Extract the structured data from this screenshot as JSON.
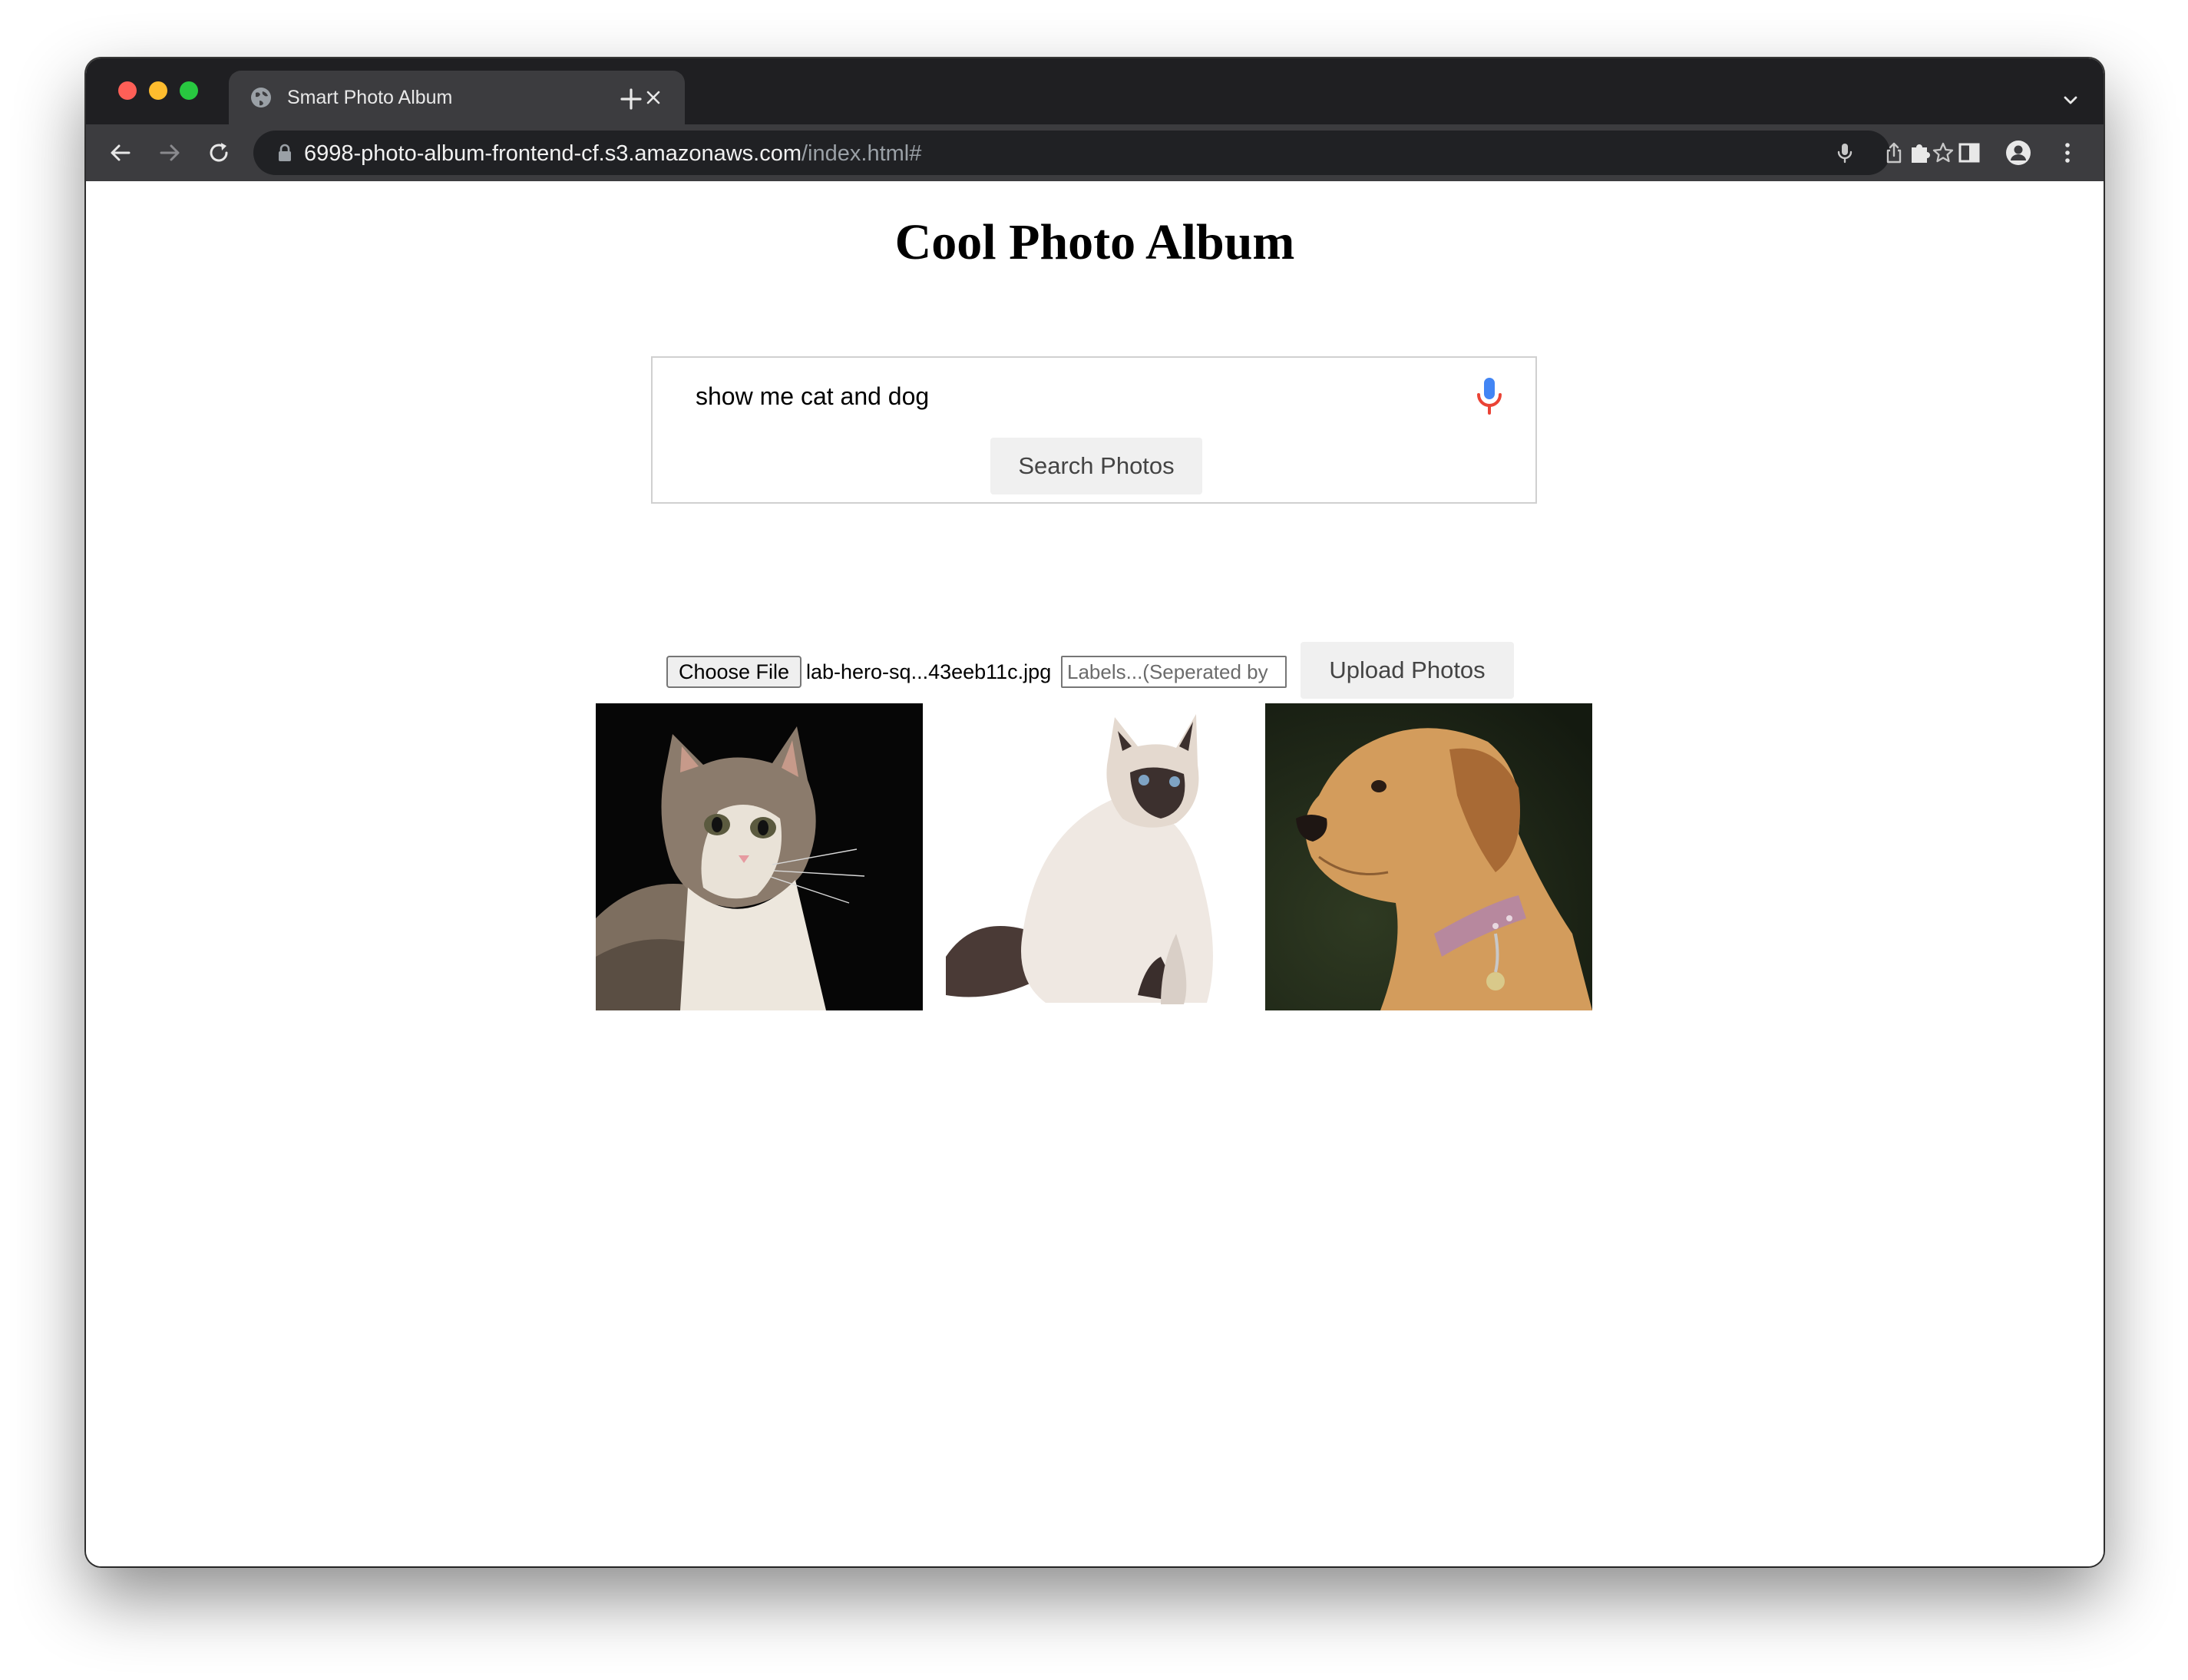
{
  "browser": {
    "tab": {
      "title": "Smart Photo Album"
    },
    "address_bar": {
      "host": "6998-photo-album-frontend-cf.s3.amazonaws.com",
      "path": "/index.html#"
    },
    "icons": {
      "tab_favicon": "globe-icon",
      "tab_close": "close-icon",
      "new_tab": "plus-icon",
      "tab_list": "chevron-down-icon",
      "back": "arrow-left-icon",
      "forward": "arrow-right-icon",
      "reload": "reload-icon",
      "lock": "lock-icon",
      "voice_search": "microphone-icon",
      "share": "share-icon",
      "bookmark": "star-icon",
      "extensions": "puzzle-icon",
      "side_panel": "side-panel-icon",
      "profile": "profile-icon",
      "menu": "kebab-menu-icon"
    }
  },
  "page": {
    "title": "Cool Photo Album",
    "search": {
      "query": "show me cat and dog",
      "button_label": "Search Photos",
      "mic_icon": "microphone-icon"
    },
    "upload": {
      "choose_file_label": "Choose File",
      "file_name": "lab-hero-sq...43eeb11c.jpg",
      "labels_placeholder": "Labels...(Seperated by",
      "button_label": "Upload Photos"
    },
    "results": [
      {
        "subject": "tabby-cat-photo"
      },
      {
        "subject": "himalayan-cat-photo"
      },
      {
        "subject": "labrador-dog-photo"
      }
    ]
  },
  "colors": {
    "tab_strip": "#1f1f22",
    "toolbar": "#3c3c3f",
    "omnibox": "#202124",
    "button_bg": "#f0f0f0",
    "mic_blue": "#4285f4",
    "mic_red": "#ea4335"
  }
}
